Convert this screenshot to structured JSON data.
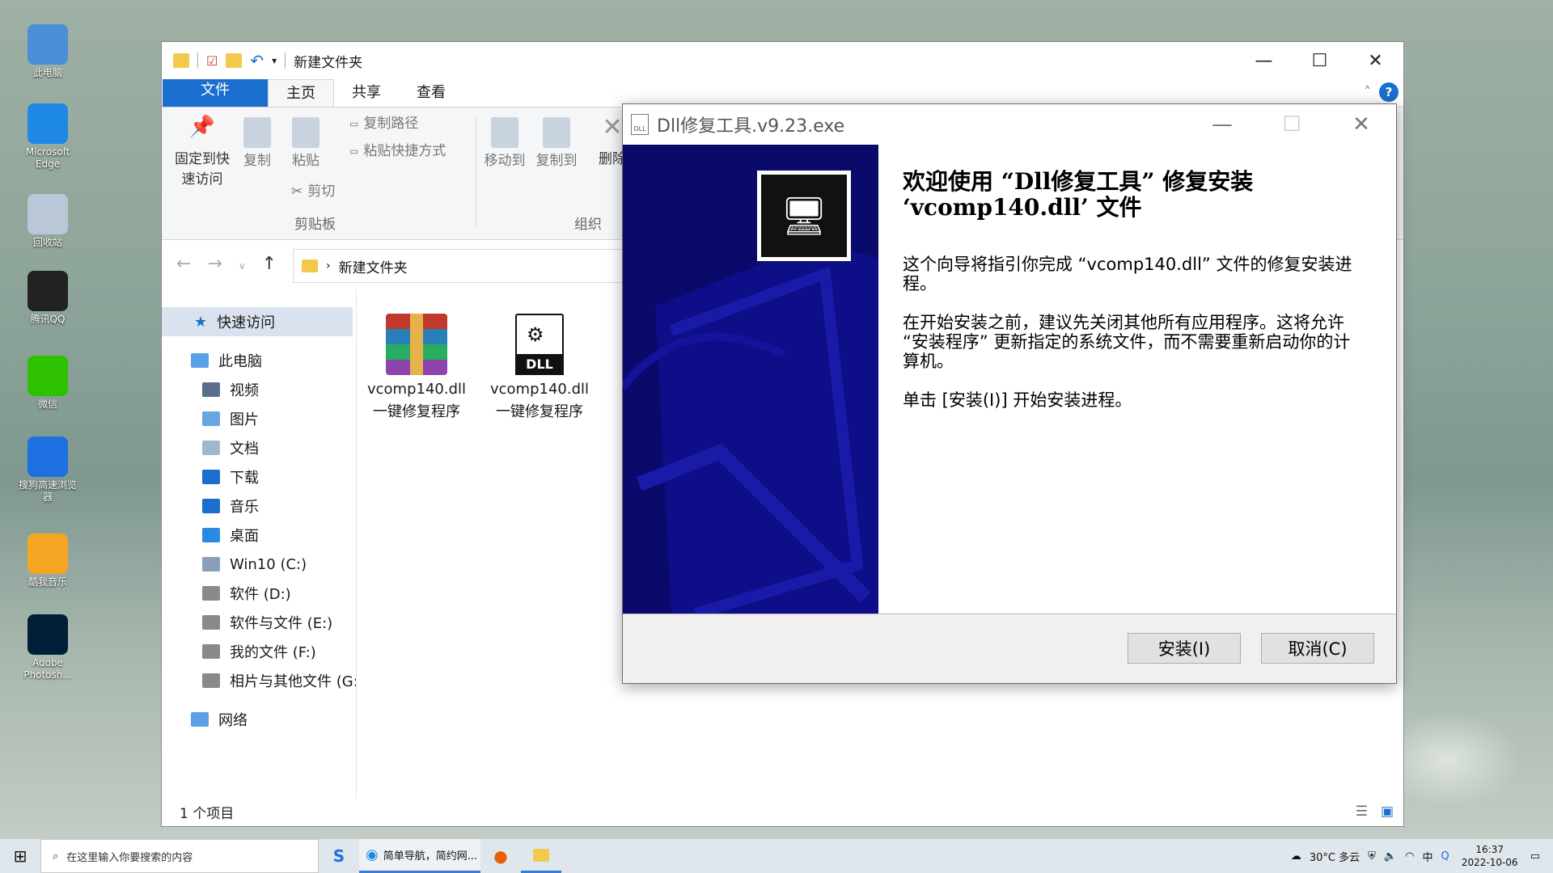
{
  "desktop": {
    "icons": [
      {
        "label": "此电脑",
        "icon": "computer-icon",
        "color": "#4a8fd8"
      },
      {
        "label": "Microsoft Edge",
        "icon": "edge-icon",
        "color": "#1e88e5"
      },
      {
        "label": "回收站",
        "icon": "recycle-bin-icon",
        "color": "#b9c7d6"
      },
      {
        "label": "腾讯QQ",
        "icon": "qq-icon",
        "color": "#222222"
      },
      {
        "label": "微信",
        "icon": "wechat-icon",
        "color": "#2dc100"
      },
      {
        "label": "搜狗高速浏览器",
        "icon": "sogou-icon",
        "color": "#1e6fe0"
      },
      {
        "label": "酷我音乐",
        "icon": "kuwo-icon",
        "color": "#f5a623"
      },
      {
        "label": "Adobe Photosh...",
        "icon": "photoshop-icon",
        "color": "#001e36"
      }
    ]
  },
  "explorer": {
    "title": "新建文件夹",
    "tabs": [
      "文件",
      "主页",
      "共享",
      "查看"
    ],
    "ribbon": {
      "pin": "固定到快速访问",
      "copy": "复制",
      "paste": "粘贴",
      "copy_path": "复制路径",
      "paste_shortcut": "粘贴快捷方式",
      "cut": "剪切",
      "group_clipboard": "剪贴板",
      "move_to": "移动到",
      "copy_to": "复制到",
      "delete": "删除",
      "group_organize": "组织"
    },
    "address": "新建文件夹",
    "nav": {
      "quick": "快速访问",
      "pc": "此电脑",
      "items": [
        "视频",
        "图片",
        "文档",
        "下载",
        "音乐",
        "桌面",
        "Win10 (C:)",
        "软件 (D:)",
        "软件与文件 (E:)",
        "我的文件 (F:)",
        "相片与其他文件 (G:"
      ],
      "network": "网络"
    },
    "files": [
      {
        "name": "vcomp140.dll",
        "sub": "一键修复程序",
        "icon": "winrar-icon"
      },
      {
        "name": "vcomp140.dll",
        "sub": "一键修复程序",
        "icon": "dll-icon"
      }
    ],
    "status": "1 个项目"
  },
  "dialog": {
    "title": "Dll修复工具.v9.23.exe",
    "heading": "欢迎使用 “Dll修复工具” 修复安装 ‘vcomp140.dll’ 文件",
    "p1": "这个向导将指引你完成 “vcomp140.dll” 文件的修复安装进程。",
    "p2": "在开始安装之前，建议先关闭其他所有应用程序。这将允许 “安装程序” 更新指定的系统文件，而不需要重新启动你的计算机。",
    "p3": "单击 [安装(I)] 开始安装进程。",
    "install": "安装(I)",
    "cancel": "取消(C)",
    "side_color": "#0a0a6a"
  },
  "taskbar": {
    "search_placeholder": "在这里输入你要搜索的内容",
    "task_label": "简单导航，简约网...",
    "weather": "30°C 多云",
    "time": "16:37",
    "date": "2022-10-06"
  }
}
